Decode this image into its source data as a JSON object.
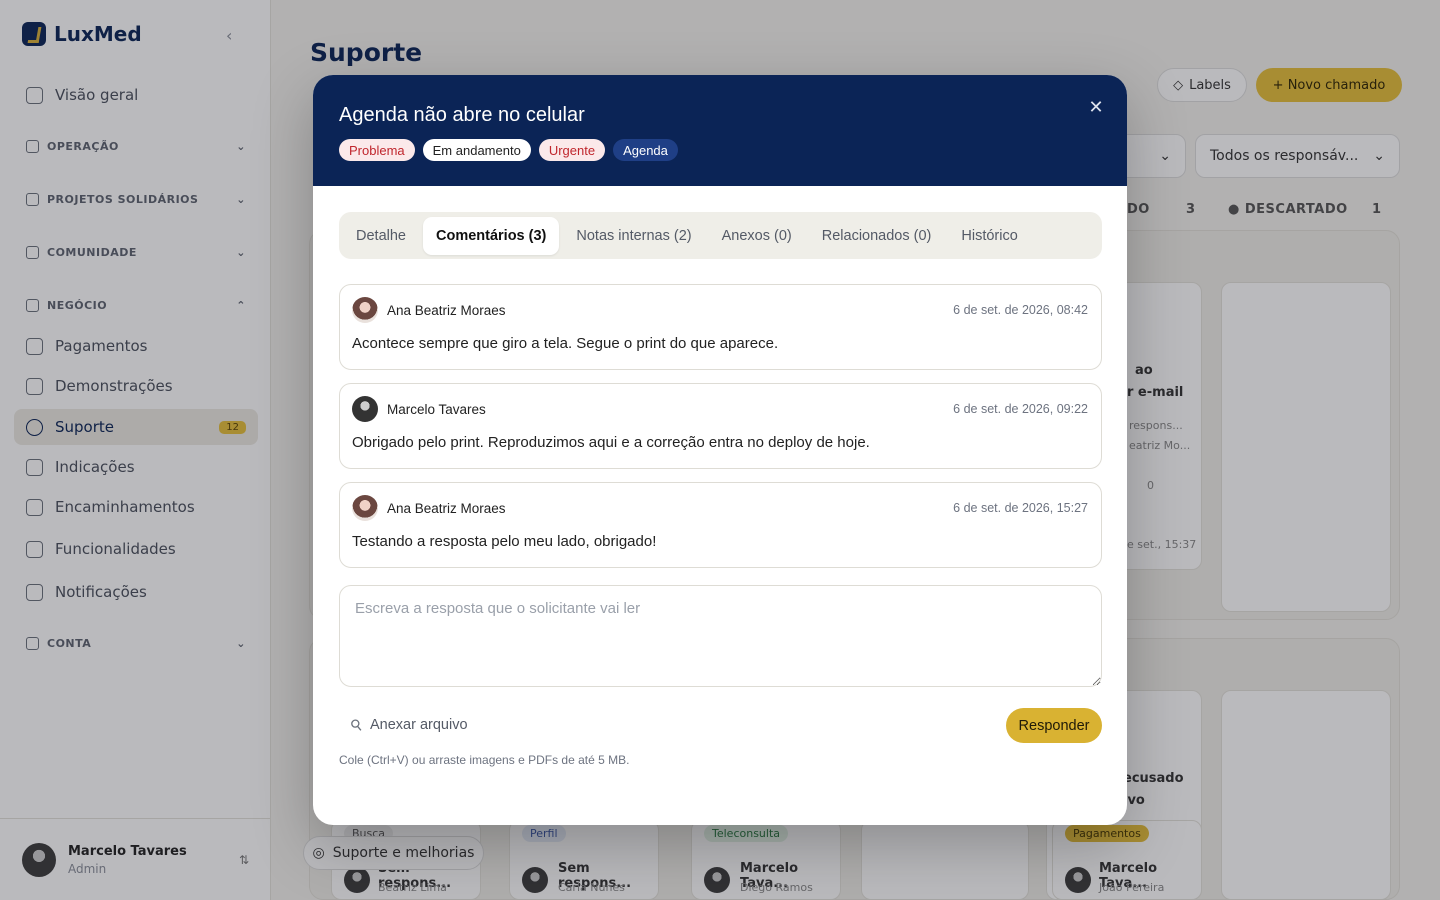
{
  "app": {
    "name": "LuxMed"
  },
  "sidebar": {
    "items": [
      {
        "label": "Visão geral"
      },
      {
        "label": "Pagamentos"
      },
      {
        "label": "Demonstrações"
      },
      {
        "label": "Suporte",
        "badge": "12"
      },
      {
        "label": "Indicações"
      },
      {
        "label": "Encaminhamentos"
      },
      {
        "label": "Funcionalidades"
      },
      {
        "label": "Notificações"
      }
    ],
    "sections": [
      {
        "label": "OPERAÇÃO"
      },
      {
        "label": "PROJETOS SOLIDÁRIOS"
      },
      {
        "label": "COMUNIDADE"
      },
      {
        "label": "NEGÓCIO"
      },
      {
        "label": "CONTA"
      }
    ],
    "user": {
      "name": "Marcelo Tavares",
      "role": "Admin"
    }
  },
  "page": {
    "title": "Suporte",
    "labels_button": "Labels",
    "new_button": "Novo chamado",
    "filter_assignee": "Todos os responsáv...",
    "columns": [
      {
        "label": "DO",
        "count": "3"
      },
      {
        "label": "DESCARTADO",
        "count": "1"
      }
    ],
    "support_pill": "Suporte e melhorias",
    "bg_cards": [
      {
        "tag": "Busca",
        "person": "Sem respons...",
        "sub": "Beatriz Lima"
      },
      {
        "tag": "Perfil",
        "person": "Sem respons...",
        "sub": "Carla Nunes"
      },
      {
        "tag": "Teleconsulta",
        "person": "Marcelo Tava...",
        "sub": "Diego Ramos"
      },
      {
        "tag": "Pagamentos",
        "person": "Marcelo Tava...",
        "sub": "João Pereira"
      }
    ],
    "bg_fragments": {
      "a": "ao",
      "b": "r e-mail",
      "c": "respons...",
      "d": "eatriz Mo...",
      "e": "0",
      "f": "e set., 15:37",
      "g": "ecusado",
      "h": "ivo"
    }
  },
  "modal": {
    "title": "Agenda não abre no celular",
    "chips": [
      "Problema",
      "Em andamento",
      "Urgente",
      "Agenda"
    ],
    "tabs": [
      "Detalhe",
      "Comentários (3)",
      "Notas internas (2)",
      "Anexos (0)",
      "Relacionados (0)",
      "Histórico"
    ],
    "active_tab": "Comentários (3)",
    "comments": [
      {
        "author": "Ana Beatriz Moraes",
        "date": "6 de set. de 2026, 08:42",
        "text": "Acontece sempre que giro a tela. Segue o print do que aparece."
      },
      {
        "author": "Marcelo Tavares",
        "date": "6 de set. de 2026, 09:22",
        "text": "Obrigado pelo print. Reproduzimos aqui e a correção entra no deploy de hoje."
      },
      {
        "author": "Ana Beatriz Moraes",
        "date": "6 de set. de 2026, 15:27",
        "text": "Testando a resposta pelo meu lado, obrigado!"
      }
    ],
    "reply_placeholder": "Escreva a resposta que o solicitante vai ler",
    "reply_value": "",
    "attach_label": "Anexar arquivo",
    "submit_label": "Responder",
    "hint": "Cole (Ctrl+V) ou arraste imagens e PDFs de até 5 MB."
  },
  "colors": {
    "brand": "#0b2456",
    "accent": "#e5bf3a",
    "danger": "#c0262d"
  }
}
